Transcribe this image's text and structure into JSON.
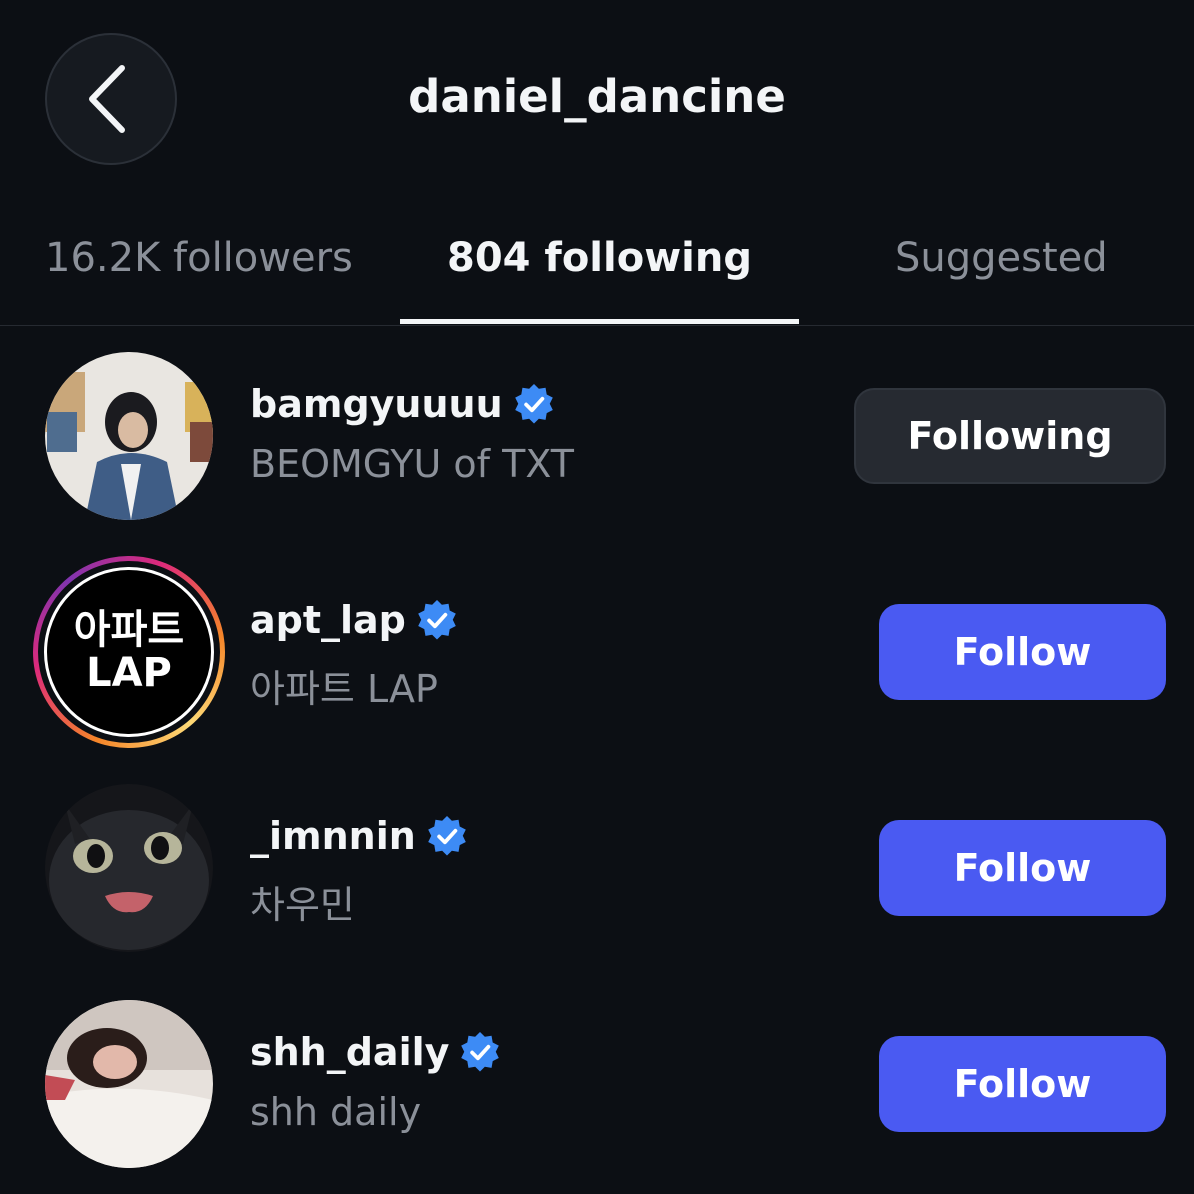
{
  "header": {
    "title": "daniel_dancine",
    "back_icon": "chevron-left-icon"
  },
  "tabs": [
    {
      "label": "16.2K followers",
      "active": false
    },
    {
      "label": "804 following",
      "active": true
    },
    {
      "label": "Suggested",
      "active": false
    }
  ],
  "users": [
    {
      "username": "bamgyuuuu",
      "full_name": "BEOMGYU of TXT",
      "verified": true,
      "has_story": false,
      "button_label": "Following",
      "button_state": "following"
    },
    {
      "username": "apt_lap",
      "full_name": "아파트 LAP",
      "verified": true,
      "has_story": true,
      "avatar_text_line1": "아파트",
      "avatar_text_line2": "LAP",
      "button_label": "Follow",
      "button_state": "follow"
    },
    {
      "username": "_imnnin",
      "full_name": "차우민",
      "verified": true,
      "has_story": false,
      "button_label": "Follow",
      "button_state": "follow"
    },
    {
      "username": "shh_daily",
      "full_name": "shh daily",
      "verified": true,
      "has_story": false,
      "button_label": "Follow",
      "button_state": "follow"
    }
  ],
  "colors": {
    "background": "#0c0f14",
    "follow_button": "#4a5af2",
    "following_button": "#262a31",
    "verified_badge": "#3d8bf5",
    "secondary_text": "#8b9099"
  }
}
